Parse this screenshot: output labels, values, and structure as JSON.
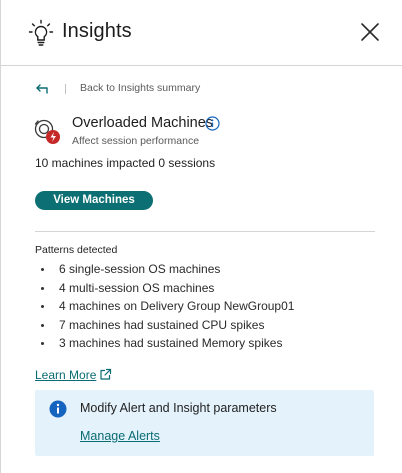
{
  "colors": {
    "accent": "#0b6f73",
    "link": "#0a6c73",
    "alert_background": "#e4f2fb",
    "info_icon_blue": "#1565c0",
    "badge_red": "#c62828"
  },
  "header": {
    "icon": "lightbulb-icon",
    "title": "Insights",
    "close_icon": "close-icon"
  },
  "nav": {
    "back_icon": "back-arrow-icon",
    "back_label": "Back to Insights summary"
  },
  "insight": {
    "icon": "overloaded-machine-icon",
    "title": "Overloaded Machines",
    "info_icon": "info-icon",
    "subtitle": "Affect session performance",
    "impact": "10 machines impacted 0 sessions",
    "view_button": "View Machines"
  },
  "patterns": {
    "label": "Patterns detected",
    "items": [
      "6 single-session OS machines",
      "4 multi-session OS machines",
      "4 machines on Delivery Group NewGroup01",
      "7 machines had sustained CPU spikes",
      "3 machines had sustained Memory spikes"
    ]
  },
  "learn_more": {
    "label": "Learn More",
    "icon": "external-link-icon"
  },
  "alert": {
    "icon": "info-icon",
    "text": "Modify Alert and Insight parameters",
    "link": "Manage Alerts"
  }
}
